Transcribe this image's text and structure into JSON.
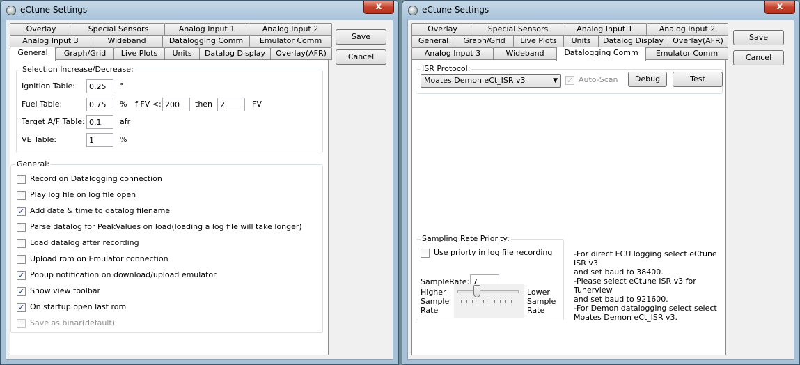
{
  "left": {
    "title": "eCtune Settings",
    "close_glyph": "x",
    "tabs_row1": [
      "Overlay",
      "Special Sensors",
      "Analog Input 1",
      "Analog Input 2"
    ],
    "tabs_row2": [
      "Analog Input 3",
      "Wideband",
      "Datalogging Comm",
      "Emulator Comm"
    ],
    "tabs_row3": [
      "General",
      "Graph/Grid",
      "Live Plots",
      "Units",
      "Datalog Display",
      "Overlay(AFR)"
    ],
    "active_tab": "General",
    "save_label": "Save",
    "cancel_label": "Cancel",
    "selection": {
      "title": "Selection Increase/Decrease:",
      "ignition_label": "Ignition Table:",
      "ignition_value": "0.25",
      "ignition_unit": "°",
      "fuel_label": "Fuel Table:",
      "fuel_value": "0.75",
      "fuel_unit": "%",
      "fuel_if_label": "if FV <:",
      "fuel_if_value": "200",
      "fuel_then_label": "then",
      "fuel_then_value": "2",
      "fuel_fv_unit": "FV",
      "afr_label": "Target A/F Table:",
      "afr_value": "0.1",
      "afr_unit": "afr",
      "ve_label": "VE Table:",
      "ve_value": "1",
      "ve_unit": "%"
    },
    "general": {
      "title": "General:",
      "options": [
        {
          "label": "Record on Datalogging connection",
          "checked": false
        },
        {
          "label": "Play log file on log file open",
          "checked": false
        },
        {
          "label": "Add date & time to datalog filename",
          "checked": true
        },
        {
          "label": "Parse datalog for PeakValues on load(loading a log file will take longer)",
          "checked": false
        },
        {
          "label": "Load datalog after recording",
          "checked": false
        },
        {
          "label": "Upload rom on Emulator connection",
          "checked": false
        },
        {
          "label": "Popup notification on download/upload emulator",
          "checked": true
        },
        {
          "label": "Show view toolbar",
          "checked": true
        },
        {
          "label": "On startup open last rom",
          "checked": true
        },
        {
          "label": "Save as binar(default)",
          "checked": false,
          "disabled": true
        }
      ]
    }
  },
  "right": {
    "title": "eCtune Settings",
    "close_glyph": "x",
    "tabs_row1": [
      "Overlay",
      "Special Sensors",
      "Analog Input 1",
      "Analog Input 2"
    ],
    "tabs_row2": [
      "General",
      "Graph/Grid",
      "Live Plots",
      "Units",
      "Datalog Display",
      "Overlay(AFR)"
    ],
    "tabs_row3": [
      "Analog Input 3",
      "Wideband",
      "Datalogging Comm",
      "Emulator Comm"
    ],
    "active_tab": "Datalogging Comm",
    "save_label": "Save",
    "cancel_label": "Cancel",
    "isr": {
      "title": "ISR Protocol:",
      "selected": "Moates Demon eCt_ISR v3",
      "autoscan_label": "Auto-Scan",
      "autoscan_checked": true,
      "debug_label": "Debug",
      "test_label": "Test"
    },
    "sampling": {
      "title": "Sampling Rate Priority:",
      "use_priority_label": "Use priorty in log file recording",
      "use_priority_checked": false,
      "samplerate_label": "SampleRate:",
      "samplerate_value": "7",
      "higher_label": "Higher\nSample\nRate",
      "lower_label": "Lower\nSample\nRate",
      "slider_position": 0.3
    },
    "info": "-For direct ECU logging select eCtune ISR v3\nand set baud to 38400.\n-Please select eCtune ISR v3 for Tunerview\nand set baud to 921600.\n-For Demon datalogging select select\nMoates Demon eCt_ISR v3."
  }
}
